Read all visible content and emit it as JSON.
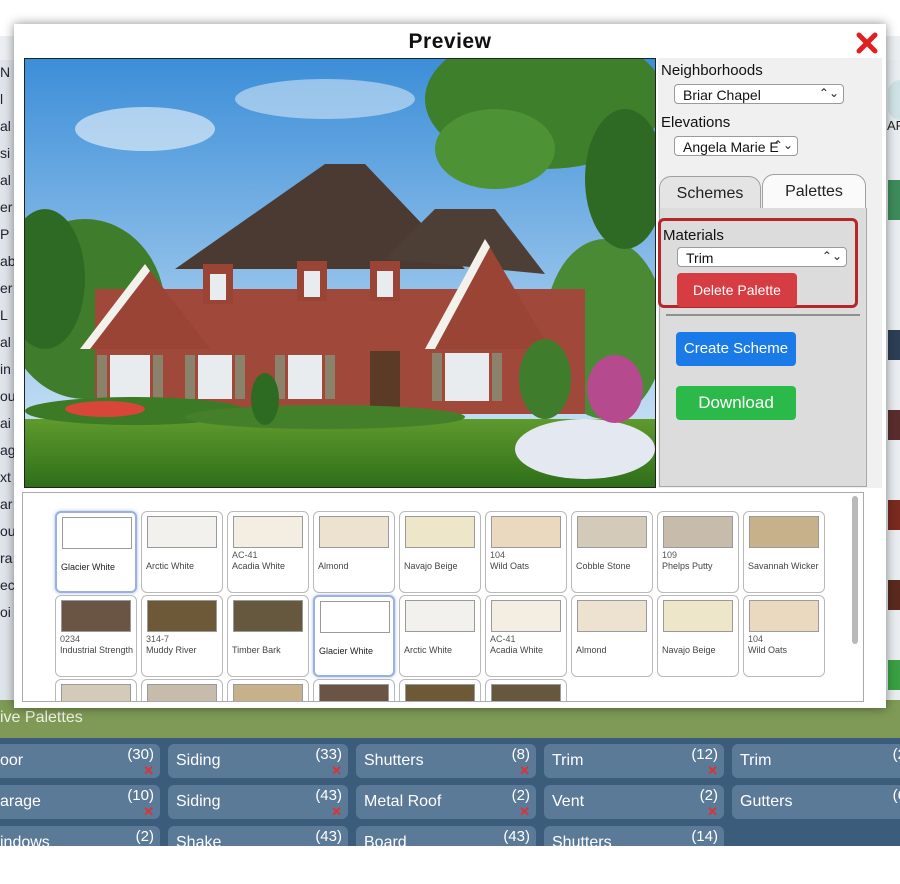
{
  "modal": {
    "title": "Preview"
  },
  "side_panel": {
    "neighborhoods_label": "Neighborhoods",
    "neighborhood_value": "Briar Chapel",
    "elevations_label": "Elevations",
    "elevation_value": "Angela Marie E",
    "tabs": [
      {
        "label": "Schemes",
        "active": false
      },
      {
        "label": "Palettes",
        "active": true
      }
    ],
    "materials_label": "Materials",
    "material_value": "Trim",
    "delete_palette_label": "Delete Palette",
    "create_scheme_label": "Create Scheme",
    "download_label": "Download"
  },
  "swatches": [
    {
      "code": "",
      "name": "Glacier White",
      "color": "#ffffff",
      "selected": true
    },
    {
      "code": "",
      "name": "Arctic White",
      "color": "#f2f1ee",
      "selected": false
    },
    {
      "code": "AC-41",
      "name": "Acadia White",
      "color": "#f3eee1",
      "selected": false
    },
    {
      "code": "",
      "name": "Almond",
      "color": "#ede2cf",
      "selected": false
    },
    {
      "code": "",
      "name": "Navajo Beige",
      "color": "#ede6c9",
      "selected": false
    },
    {
      "code": "104",
      "name": "Wild Oats",
      "color": "#ead8bf",
      "selected": false
    },
    {
      "code": "",
      "name": "Cobble Stone",
      "color": "#d4cab9",
      "selected": false
    },
    {
      "code": "109",
      "name": "Phelps Putty",
      "color": "#c7bcab",
      "selected": false
    },
    {
      "code": "",
      "name": "Savannah Wicker",
      "color": "#c6b18a",
      "selected": false
    },
    {
      "code": "0234",
      "name": "Industrial Strength",
      "color": "#6a5443",
      "selected": false
    },
    {
      "code": "314-7",
      "name": "Muddy River",
      "color": "#6d5938",
      "selected": false
    },
    {
      "code": "",
      "name": "Timber Bark",
      "color": "#66573f",
      "selected": false
    },
    {
      "code": "",
      "name": "Glacier White",
      "color": "#ffffff",
      "selected": true
    },
    {
      "code": "",
      "name": "Arctic White",
      "color": "#f2f1ee",
      "selected": false
    },
    {
      "code": "AC-41",
      "name": "Acadia White",
      "color": "#f3eee1",
      "selected": false
    },
    {
      "code": "",
      "name": "Almond",
      "color": "#ede2cf",
      "selected": false
    },
    {
      "code": "",
      "name": "Navajo Beige",
      "color": "#ede6c9",
      "selected": false
    },
    {
      "code": "104",
      "name": "Wild Oats",
      "color": "#ead8bf",
      "selected": false
    },
    {
      "code": "",
      "name": "",
      "color": "#d4cab9",
      "selected": false
    },
    {
      "code": "",
      "name": "",
      "color": "#c7bcab",
      "selected": false
    },
    {
      "code": "",
      "name": "",
      "color": "#c6b18a",
      "selected": false
    },
    {
      "code": "",
      "name": "",
      "color": "#6a5443",
      "selected": false
    },
    {
      "code": "",
      "name": "",
      "color": "#6d5938",
      "selected": false
    },
    {
      "code": "",
      "name": "",
      "color": "#66573f",
      "selected": false
    }
  ],
  "background": {
    "left_letters": [
      "N",
      "l",
      "al",
      "si",
      "al",
      "er",
      "P",
      "ab",
      "er",
      "L",
      "al",
      "in",
      "ou",
      "ai",
      "ag",
      "xt",
      "ar",
      "ou",
      "ra",
      "ec",
      "oi"
    ],
    "palettes_heading": "ive Palettes",
    "right_text": "AP",
    "chips": [
      {
        "name": "oor",
        "count": "(30)",
        "x": true
      },
      {
        "name": "Siding",
        "count": "(33)",
        "x": true
      },
      {
        "name": "Shutters",
        "count": "(8)",
        "x": true
      },
      {
        "name": "Trim",
        "count": "(12)",
        "x": true
      },
      {
        "name": "Trim",
        "count": "(2",
        "x": false
      },
      {
        "name": "arage",
        "count": "(10)",
        "x": true
      },
      {
        "name": "Siding",
        "count": "(43)",
        "x": true
      },
      {
        "name": "Metal Roof",
        "count": "(2)",
        "x": true
      },
      {
        "name": "Vent",
        "count": "(2)",
        "x": true
      },
      {
        "name": "Gutters",
        "count": "(6",
        "x": false
      },
      {
        "name": "indows",
        "count": "(2)",
        "x": false
      },
      {
        "name": "Shake",
        "count": "(43)",
        "x": false
      },
      {
        "name": "Board",
        "count": "(43)",
        "x": false
      },
      {
        "name": "Shutters",
        "count": "(14)",
        "x": false
      }
    ]
  },
  "colors": {
    "delete": "#d63d43",
    "create": "#1a7ae8",
    "download": "#2bba4a",
    "highlight": "#b5262b",
    "close": "#e02020"
  }
}
